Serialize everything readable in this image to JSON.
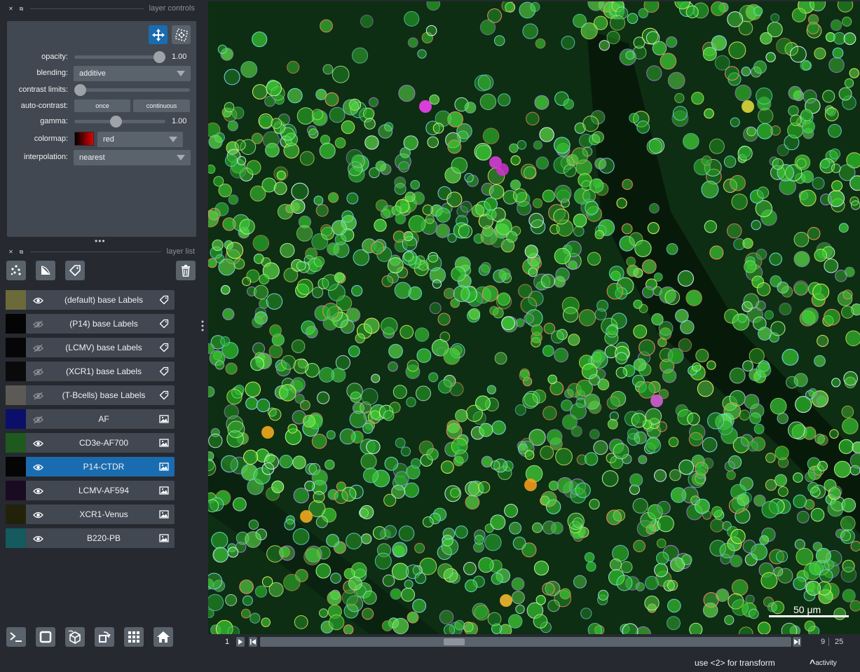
{
  "dock": {
    "controls_title": "layer controls",
    "list_title": "layer list"
  },
  "controls": {
    "opacity_label": "opacity:",
    "opacity_value": "1.00",
    "opacity_fraction": 1.0,
    "blending_label": "blending:",
    "blending_value": "additive",
    "contrast_label": "contrast limits:",
    "contrast_low_fraction": 0.0,
    "autocontrast_label": "auto-contrast:",
    "once_label": "once",
    "continuous_label": "continuous",
    "gamma_label": "gamma:",
    "gamma_value": "1.00",
    "gamma_fraction": 0.45,
    "colormap_label": "colormap:",
    "colormap_value": "red",
    "colormap_color": "#e00000",
    "interpolation_label": "interpolation:",
    "interpolation_value": "nearest",
    "accent_color": "#1a6cb0"
  },
  "layers": [
    {
      "name": "(default) base Labels",
      "visible": true,
      "type": "labels",
      "thumb_color": "#6b6a3a",
      "selected": false
    },
    {
      "name": "(P14) base Labels",
      "visible": false,
      "type": "labels",
      "thumb_color": "#040404",
      "selected": false
    },
    {
      "name": "(LCMV) base Labels",
      "visible": false,
      "type": "labels",
      "thumb_color": "#060608",
      "selected": false
    },
    {
      "name": "(XCR1) base Labels",
      "visible": false,
      "type": "labels",
      "thumb_color": "#0a0a0a",
      "selected": false
    },
    {
      "name": "(T-Bcells) base Labels",
      "visible": false,
      "type": "labels",
      "thumb_color": "#5d5a55",
      "selected": false
    },
    {
      "name": "AF",
      "visible": false,
      "type": "image",
      "thumb_color": "#0b0f6a",
      "selected": false
    },
    {
      "name": "CD3e-AF700",
      "visible": true,
      "type": "image",
      "thumb_color": "#1e5a1e",
      "selected": false
    },
    {
      "name": "P14-CTDR",
      "visible": true,
      "type": "image",
      "thumb_color": "#050505",
      "selected": true
    },
    {
      "name": "LCMV-AF594",
      "visible": true,
      "type": "image",
      "thumb_color": "#1a0a22",
      "selected": false
    },
    {
      "name": "XCR1-Venus",
      "visible": true,
      "type": "image",
      "thumb_color": "#22220a",
      "selected": false
    },
    {
      "name": "B220-PB",
      "visible": true,
      "type": "image",
      "thumb_color": "#145a5e",
      "selected": false
    }
  ],
  "canvas": {
    "scalebar_label": "50 μm"
  },
  "dims": {
    "axis": "1",
    "current": "9",
    "total": "25",
    "fraction": 0.36
  },
  "status": {
    "message": "use <2> for transform",
    "activity": "activity"
  }
}
